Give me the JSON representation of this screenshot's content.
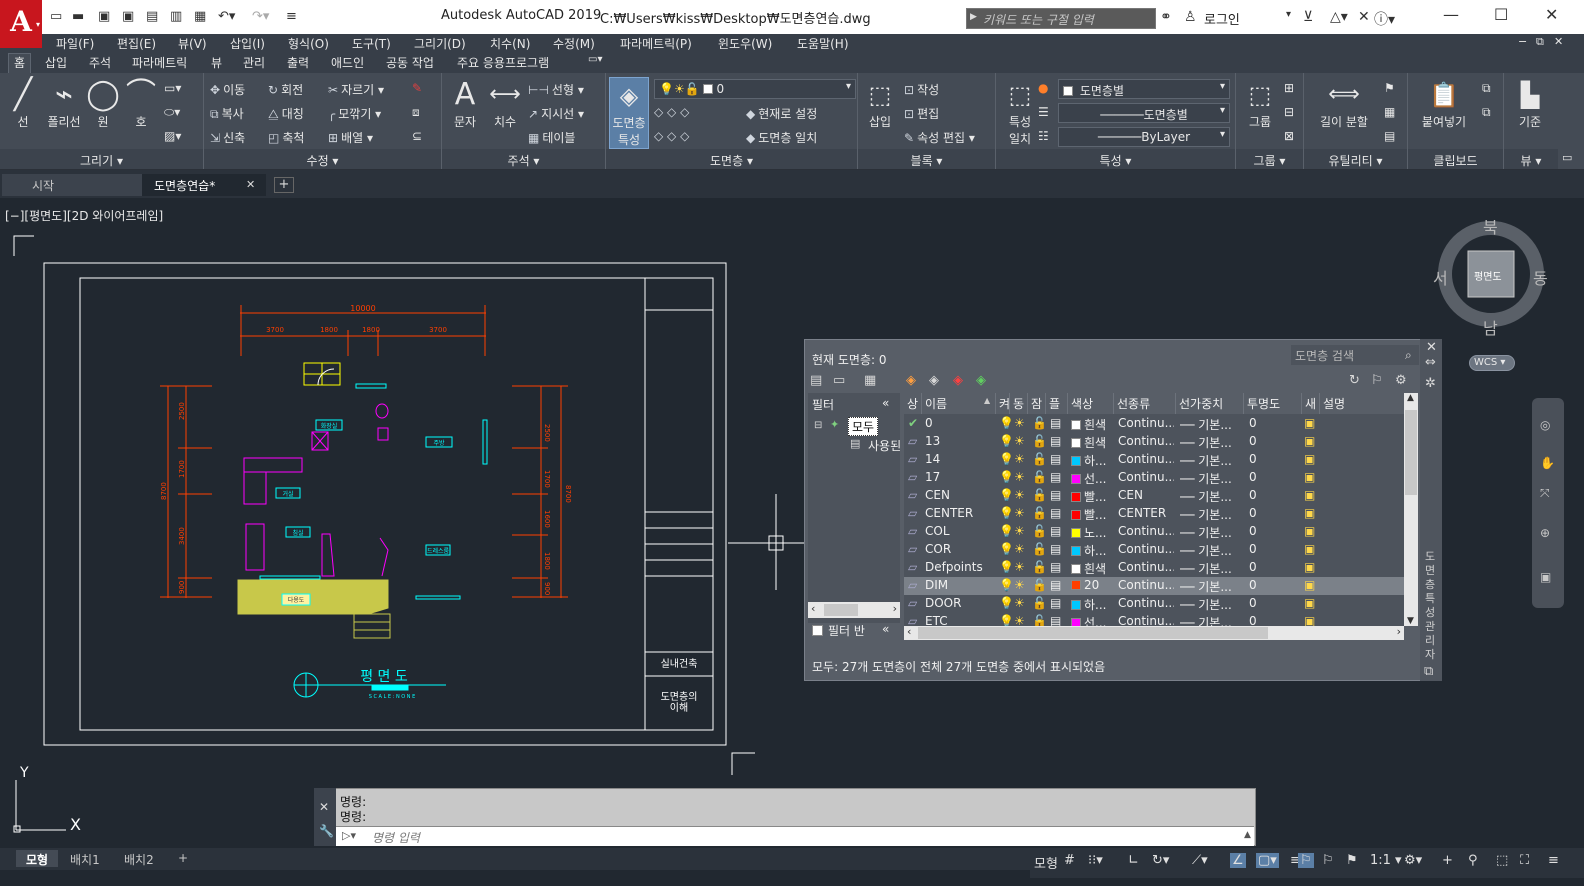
{
  "app": {
    "title": "Autodesk AutoCAD 2019",
    "file_path": "C:₩Users₩kiss₩Desktop₩도면층연습.dwg",
    "logo": "A",
    "search_placeholder": "키워드 또는 구절 입력",
    "login": "로그인"
  },
  "menu": [
    "파일(F)",
    "편집(E)",
    "뷰(V)",
    "삽입(I)",
    "형식(O)",
    "도구(T)",
    "그리기(D)",
    "치수(N)",
    "수정(M)",
    "파라메트릭(P)",
    "윈도우(W)",
    "도움말(H)"
  ],
  "ribbon_tabs": [
    "홈",
    "삽입",
    "주석",
    "파라메트릭",
    "뷰",
    "관리",
    "출력",
    "애드인",
    "공동 작업",
    "주요 응용프로그램"
  ],
  "ribbon": {
    "draw": {
      "title": "그리기 ▾",
      "line": "선",
      "polyline": "폴리선",
      "circle": "원",
      "arc": "호"
    },
    "modify": {
      "title": "수정 ▾",
      "move": "이동",
      "rotate": "회전",
      "trim": "자르기",
      "copy": "복사",
      "mirror": "대칭",
      "fillet": "모깎기",
      "stretch": "신축",
      "scale": "축척",
      "array": "배열"
    },
    "annotation": {
      "title": "주석 ▾",
      "text": "문자",
      "dimension": "치수",
      "linear": "선형",
      "leader": "지시선",
      "table": "테이블"
    },
    "layers": {
      "title": "도면층 ▾",
      "properties_line1": "도면층",
      "properties_line2": "특성",
      "current_layer": "0",
      "set_current": "현재로 설정",
      "match": "도면층 일치"
    },
    "block": {
      "title": "블록 ▾",
      "insert": "삽입",
      "create": "작성",
      "edit": "편집",
      "edit_attributes": "속성 편집"
    },
    "properties": {
      "title": "특성 ▾",
      "match_line1": "특성",
      "match_line2": "일치",
      "color": "도면층별",
      "linetype": "도면층별",
      "lineweight": "ByLayer"
    },
    "groups": {
      "title": "그룹 ▾",
      "group": "그룹"
    },
    "utilities": {
      "title": "유틸리티 ▾",
      "measure": "길이 분할"
    },
    "clipboard": {
      "title": "클립보드",
      "paste": "붙여넣기"
    },
    "view": {
      "title": "뷰 ▾",
      "base": "기준"
    }
  },
  "file_tabs": {
    "start": "시작",
    "current": "도면층연습*"
  },
  "viewport_label": "[−][평면도][2D 와이어프레임]",
  "drawing": {
    "dim_total": "10000",
    "dim_parts": [
      "3700",
      "1800",
      "1800",
      "3700"
    ],
    "title_text": "평 면 도",
    "subtitle": "S C A L E : N O N E",
    "tb_label1": "실내건축",
    "tb_label2_line1": "도면층의",
    "tb_label2_line2": "이해",
    "room_labels": [
      "화장실",
      "주방",
      "거실",
      "침실",
      "드레스룸",
      "다용도"
    ],
    "left_dims": [
      "2500",
      "1700",
      "3400",
      "900"
    ],
    "left_total": "8700",
    "right_dims": [
      "2500",
      "1700",
      "1600",
      "1800",
      "900"
    ],
    "right_total": "8700"
  },
  "viewcube": {
    "north": "북",
    "south": "남",
    "east": "동",
    "west": "서",
    "face": "평면도",
    "wcs": "WCS ▾"
  },
  "layer_manager": {
    "current_layer": "현재 도면층: 0",
    "search": "도면층 검색",
    "filters_header": "필터",
    "tree_all": "모두",
    "tree_used": "사용된",
    "invert_filter": "필터 반",
    "palette_title": "도면층 특성 관리자",
    "columns": [
      "상",
      "이름",
      "켜",
      "동",
      "잠",
      "플",
      "색상",
      "선종류",
      "선가중치",
      "투명도",
      "새",
      "설명"
    ],
    "layers": [
      {
        "name": "0",
        "color_name": "흰색",
        "color": "#ffffff",
        "linetype": "Continu...",
        "lineweight": "기본...",
        "transparency": "0",
        "current": true
      },
      {
        "name": "13",
        "color_name": "흰색",
        "color": "#ffffff",
        "linetype": "Continu...",
        "lineweight": "기본...",
        "transparency": "0"
      },
      {
        "name": "14",
        "color_name": "하...",
        "color": "#00c8ff",
        "linetype": "Continu...",
        "lineweight": "기본...",
        "transparency": "0"
      },
      {
        "name": "17",
        "color_name": "선...",
        "color": "#ff00ff",
        "linetype": "Continu...",
        "lineweight": "기본...",
        "transparency": "0"
      },
      {
        "name": "CEN",
        "color_name": "빨...",
        "color": "#ff0000",
        "linetype": "CEN",
        "lineweight": "기본...",
        "transparency": "0"
      },
      {
        "name": "CENTER",
        "color_name": "빨...",
        "color": "#ff0000",
        "linetype": "CENTER",
        "lineweight": "기본...",
        "transparency": "0"
      },
      {
        "name": "COL",
        "color_name": "노...",
        "color": "#ffff00",
        "linetype": "Continu...",
        "lineweight": "기본...",
        "transparency": "0"
      },
      {
        "name": "COR",
        "color_name": "하...",
        "color": "#00c8ff",
        "linetype": "Continu...",
        "lineweight": "기본...",
        "transparency": "0"
      },
      {
        "name": "Defpoints",
        "color_name": "흰색",
        "color": "#ffffff",
        "linetype": "Continu...",
        "lineweight": "기본...",
        "transparency": "0"
      },
      {
        "name": "DIM",
        "color_name": "20",
        "color": "#ff3f00",
        "linetype": "Continu...",
        "lineweight": "기본...",
        "transparency": "0",
        "selected": true
      },
      {
        "name": "DOOR",
        "color_name": "하...",
        "color": "#00c8ff",
        "linetype": "Continu...",
        "lineweight": "기본...",
        "transparency": "0"
      },
      {
        "name": "ETC",
        "color_name": "선...",
        "color": "#ff00ff",
        "linetype": "Continu...",
        "lineweight": "기본...",
        "transparency": "0"
      }
    ],
    "status": "모두: 27개 도면층이 전체 27개 도면층 중에서 표시되었음"
  },
  "command": {
    "history": [
      "명령:",
      "명령:"
    ],
    "placeholder": "명령 입력"
  },
  "layout_tabs": [
    "모형",
    "배치1",
    "배치2",
    "+"
  ],
  "status_bar": {
    "model": "모형",
    "scale": "1:1 ▾"
  },
  "ucs": {
    "y": "Y",
    "x": "X"
  }
}
